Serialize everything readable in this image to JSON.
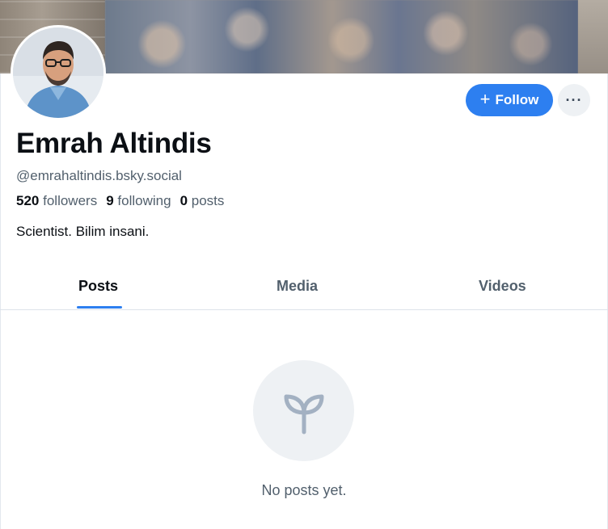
{
  "profile": {
    "name": "Emrah Altindis",
    "handle": "@emrahaltindis.bsky.social",
    "bio": "Scientist. Bilim insani.",
    "stats": {
      "followers_count": "520",
      "followers_label": "followers",
      "following_count": "9",
      "following_label": "following",
      "posts_count": "0",
      "posts_label": "posts"
    }
  },
  "actions": {
    "follow_label": "Follow",
    "follow_icon": "plus-icon",
    "more_label": "···",
    "more_icon": "ellipsis-icon"
  },
  "tabs": [
    {
      "label": "Posts",
      "active": true
    },
    {
      "label": "Media",
      "active": false
    },
    {
      "label": "Videos",
      "active": false
    }
  ],
  "empty_state": {
    "icon": "sprout-icon",
    "text": "No posts yet."
  },
  "colors": {
    "accent": "#2d7ff0",
    "muted_text": "#52606d",
    "empty_icon_bg": "#eef1f4"
  }
}
